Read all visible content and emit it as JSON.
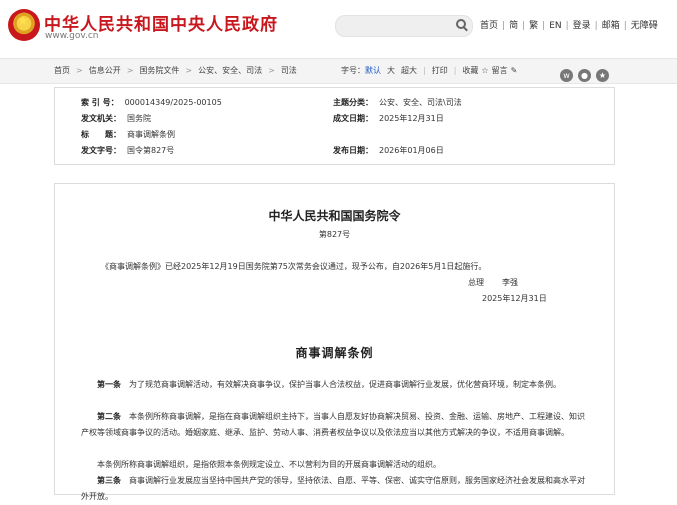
{
  "header": {
    "site_title": "中华人民共和国中央人民政府",
    "site_url": "www.gov.cn",
    "search_placeholder": "",
    "links": [
      "首页",
      "简",
      "繁",
      "EN",
      "登录",
      "邮箱",
      "无障碍"
    ]
  },
  "breadcrumb": [
    "首页",
    "信息公开",
    "国务院文件",
    "公安、安全、司法",
    "司法"
  ],
  "tools": {
    "font_label": "字号：",
    "font_default": "默认",
    "font_large": "大",
    "font_xlarge": "超大",
    "print": "打印",
    "favorite": "收藏",
    "comment": "留言"
  },
  "meta": {
    "index_label": "索 引 号：",
    "index_value": "000014349/2025-00105",
    "category_label": "主题分类：",
    "category_value": "公安、安全、司法\\司法",
    "issuer_label": "发文机关：",
    "issuer_value": "国务院",
    "created_label": "成文日期：",
    "created_value": "2025年12月31日",
    "title_label": "标　　题：",
    "title_value": "商事调解条例",
    "docno_label": "发文字号：",
    "docno_value": "国令第827号",
    "published_label": "发布日期：",
    "published_value": "2026年01月06日"
  },
  "doc": {
    "order_title": "中华人民共和国国务院令",
    "order_no": "第827号",
    "intro": "《商事调解条例》已经2025年12月19日国务院第75次常务会议通过，现予公布，自2026年5月1日起施行。",
    "signer_title": "总理",
    "signer_name": "李强",
    "sign_date": "2025年12月31日",
    "reg_title": "商事调解条例",
    "art1_label": "第一条",
    "art1_text": "为了规范商事调解活动，有效解决商事争议，保护当事人合法权益，促进商事调解行业发展，优化营商环境，制定本条例。",
    "art2_label": "第二条",
    "art2_text": "本条例所称商事调解，是指在商事调解组织主持下，当事人自愿友好协商解决贸易、投资、金融、运输、房地产、工程建设、知识产权等领域商事争议的活动。婚姻家庭、继承、监护、劳动人事、消费者权益争议以及依法应当以其他方式解决的争议，不适用商事调解。",
    "art2_para2": "本条例所称商事调解组织，是指依照本条例规定设立、不以营利为目的开展商事调解活动的组织。",
    "art3_label": "第三条",
    "art3_text": "商事调解行业发展应当坚持中国共产党的领导，坚持依法、自愿、平等、保密、诚实守信原则，服务国家经济社会发展和高水平对外开放。"
  }
}
